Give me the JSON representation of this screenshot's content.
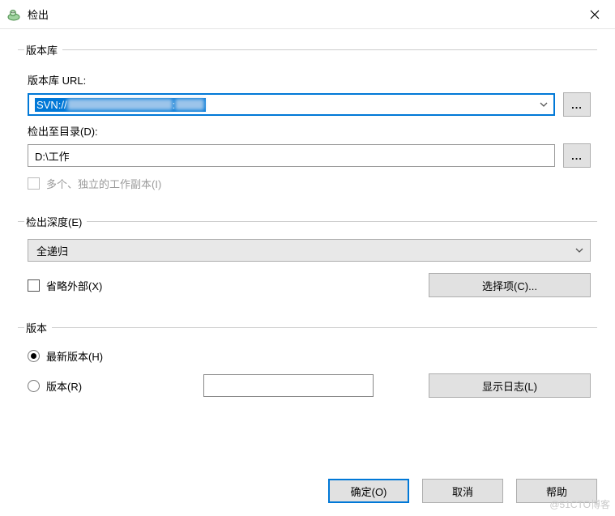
{
  "window": {
    "title": "检出"
  },
  "groups": {
    "repo": {
      "legend": "版本库",
      "url_label": "版本库 URL:",
      "url_prefix": "SVN://",
      "dir_label": "检出至目录(D):",
      "dir_value": "D:\\工作",
      "indep_label": "多个、独立的工作副本(I)",
      "browse": "..."
    },
    "depth": {
      "legend": "检出深度(E)",
      "select_value": "全递归",
      "omit_ext": "省略外部(X)",
      "options_btn": "选择项(C)..."
    },
    "rev": {
      "legend": "版本",
      "head": "最新版本(H)",
      "rev": "版本(R)",
      "log_btn": "显示日志(L)"
    }
  },
  "footer": {
    "ok": "确定(O)",
    "cancel": "取消",
    "help": "帮助"
  },
  "watermark": "@51CTO博客"
}
